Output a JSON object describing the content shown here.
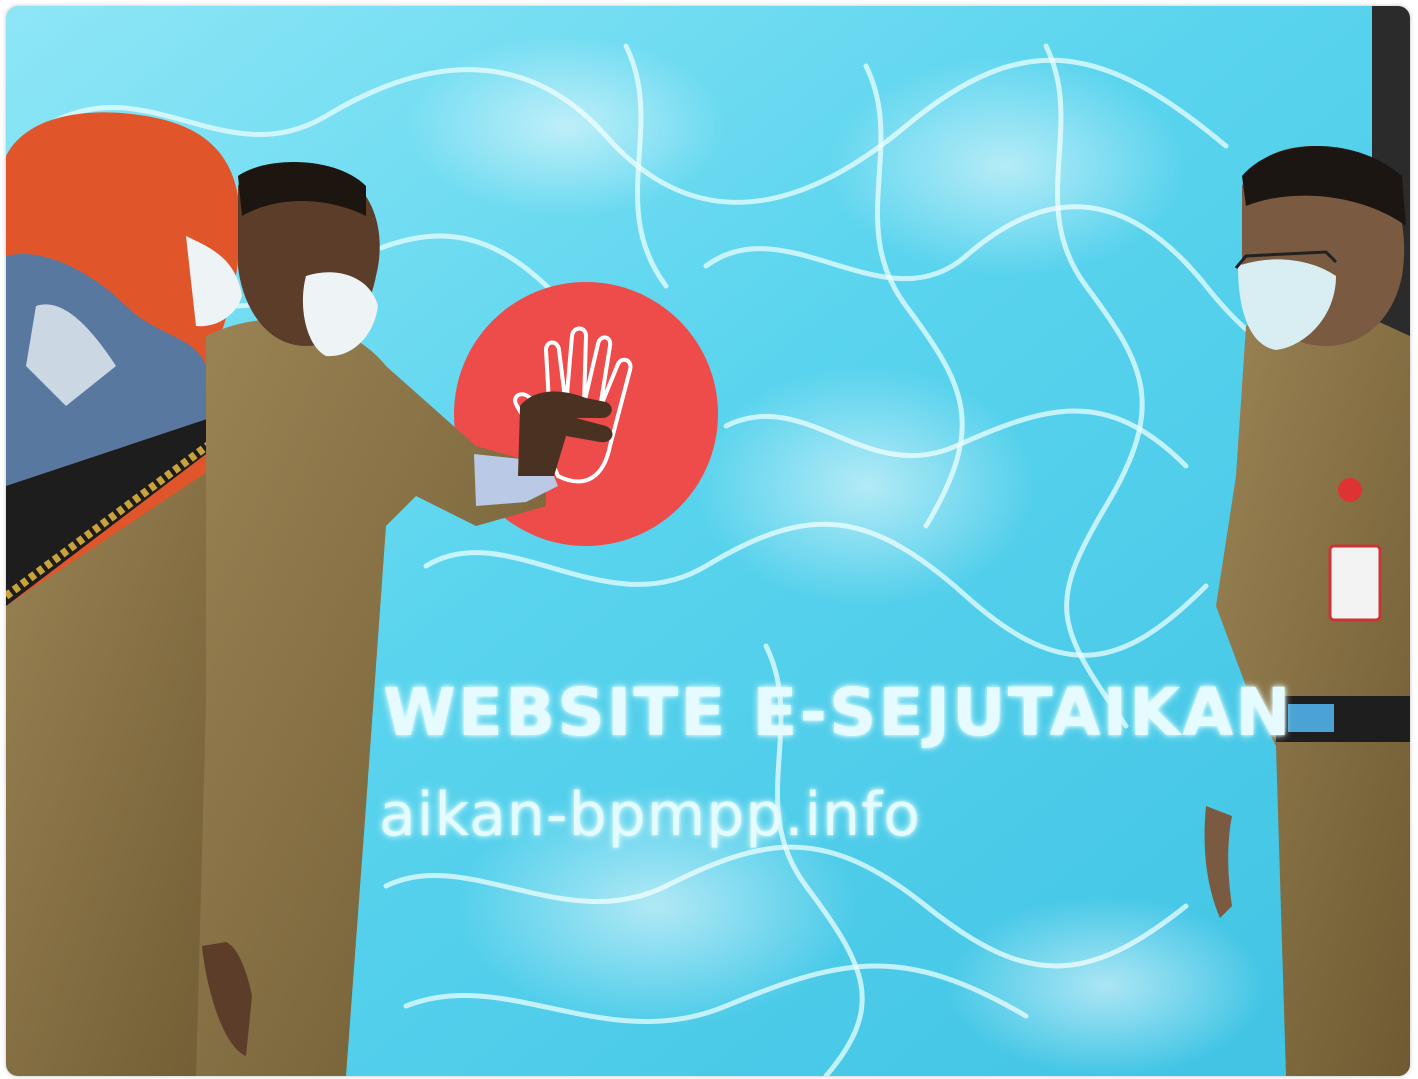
{
  "screen": {
    "title": "WEBSITE E-SEJUTAIKAN",
    "url": "aikan-bpmpp.info"
  },
  "colors": {
    "water_light": "#aef0fb",
    "water_mid": "#4fd0ea",
    "water_dark": "#1f9fcc",
    "button_red": "#ee4b4b",
    "uniform_khaki": "#8c7545",
    "hijab_orange": "#e0552a"
  },
  "icons": [
    "hand-print-icon"
  ]
}
